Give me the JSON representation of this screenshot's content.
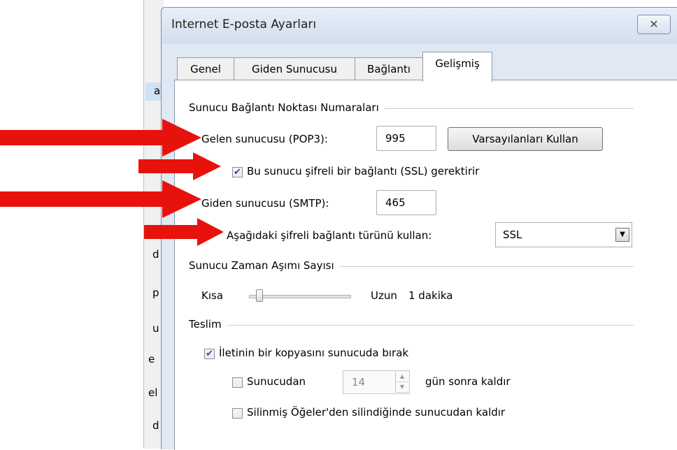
{
  "background_window": {
    "fragments": [
      "a",
      "d",
      "p",
      "u",
      "e",
      "el",
      "d"
    ]
  },
  "dialog": {
    "title": "Internet E-posta Ayarları",
    "close_glyph": "✕",
    "tabs": [
      {
        "label": "Genel"
      },
      {
        "label": "Giden Sunucusu"
      },
      {
        "label": "Bağlantı"
      },
      {
        "label": "Gelişmiş"
      }
    ],
    "ports": {
      "group_title": "Sunucu Bağlantı Noktası Numaraları",
      "incoming_label": "Gelen sunucusu (POP3):",
      "incoming_value": "995",
      "defaults_button": "Varsayılanları Kullan",
      "ssl_checkbox_label": "Bu sunucu şifreli bir bağlantı (SSL) gerektirir",
      "ssl_checked": true,
      "outgoing_label": "Giden sunucusu (SMTP):",
      "outgoing_value": "465",
      "encryption_label": "Aşağıdaki şifreli bağlantı türünü kullan:",
      "encryption_value": "SSL"
    },
    "timeout": {
      "group_title": "Sunucu Zaman Aşımı Sayısı",
      "short_label": "Kısa",
      "long_label": "Uzun",
      "value_text": "1 dakika"
    },
    "delivery": {
      "group_title": "Teslim",
      "leave_copy_label": "İletinin bir kopyasını sunucuda bırak",
      "leave_copy_checked": true,
      "remove_after_label": "Sunucudan",
      "remove_after_checked": false,
      "days_value": "14",
      "days_suffix": "gün sonra kaldır",
      "remove_deleted_label": "Silinmiş Öğeler'den silindiğinde sunucudan kaldır",
      "remove_deleted_checked": false
    }
  },
  "colors": {
    "arrow": "#e8120c",
    "checkmark": "#2b4aa0",
    "dialog_bg": "#dfe8f3"
  }
}
